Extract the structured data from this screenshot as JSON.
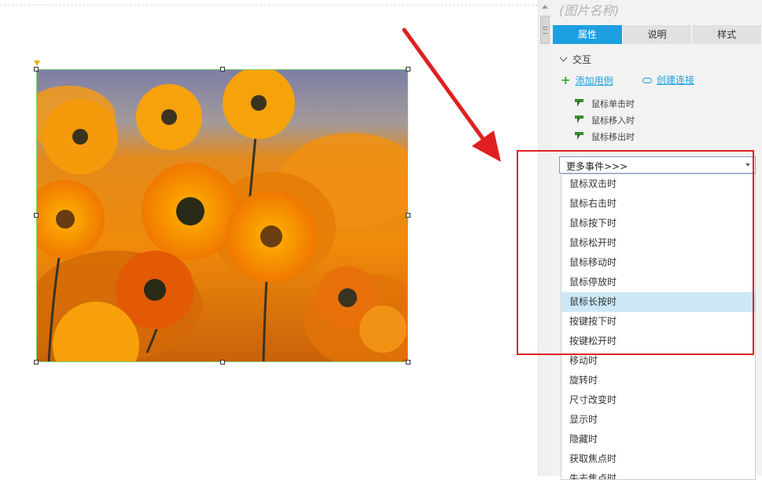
{
  "panel": {
    "title": "(图片名称)",
    "tabs": [
      {
        "label": "属性",
        "active": true
      },
      {
        "label": "说明",
        "active": false
      },
      {
        "label": "样式",
        "active": false
      }
    ],
    "section_title": "交互",
    "add_case_label": "添加用例",
    "create_link_label": "创建连接",
    "events": [
      "鼠标单击时",
      "鼠标移入时",
      "鼠标移出时"
    ]
  },
  "dropdown": {
    "selected": "更多事件>>>",
    "options": [
      "鼠标双击时",
      "鼠标右击时",
      "鼠标按下时",
      "鼠标松开时",
      "鼠标移动时",
      "鼠标停放时",
      "鼠标长按时",
      "按键按下时",
      "按键松开时",
      "移动时",
      "旋转时",
      "尺寸改变时",
      "显示时",
      "隐藏时",
      "获取焦点时",
      "失去焦点时"
    ],
    "highlighted_option": "鼠标长按时"
  },
  "colors": {
    "accent": "#1e9fe0",
    "highlight_box": "#e02020",
    "selection": "#cce8f7",
    "widget_border": "#7fd36b"
  },
  "canvas": {
    "image_subject": "orange daisy flowers photo"
  }
}
